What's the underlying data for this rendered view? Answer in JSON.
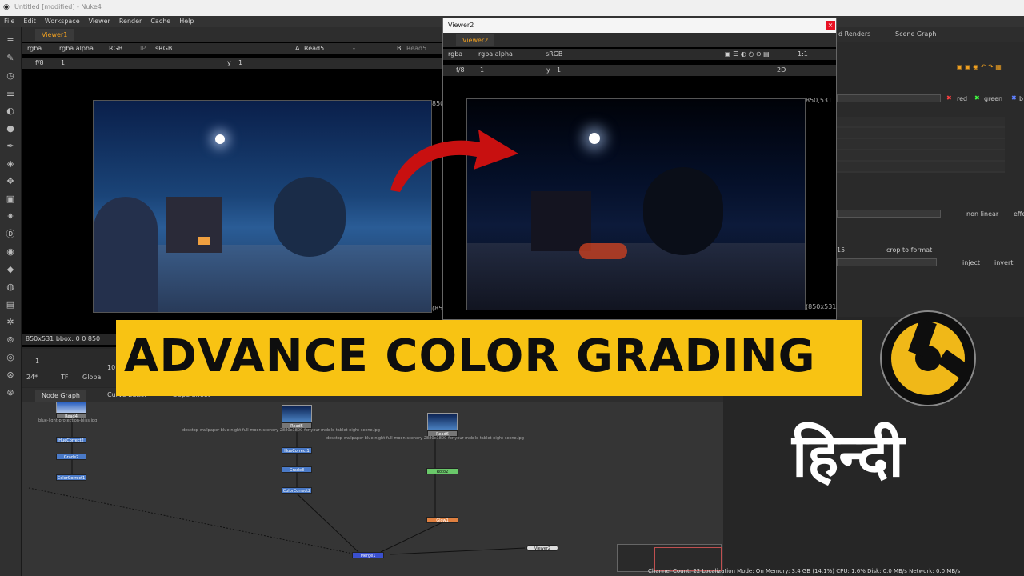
{
  "window": {
    "title": "Untitled [modified] - Nuke4"
  },
  "menu": [
    "File",
    "Edit",
    "Workspace",
    "Viewer",
    "Render",
    "Cache",
    "Help"
  ],
  "viewer1": {
    "tab": "Viewer1",
    "channels": "rgba",
    "alpha": "rgba.alpha",
    "rgb": "RGB",
    "ip": "IP",
    "lut": "sRGB",
    "a_label": "A",
    "a_input": "Read5",
    "dash": "-",
    "b_label": "B",
    "b_input": "Read5",
    "fstop": "f/8",
    "frame": "1",
    "y_label": "y",
    "y_value": "1",
    "format_right": "850",
    "format_bottom": "(85",
    "info": "850x531  bbox: 0 0 850"
  },
  "viewer2": {
    "window_title": "Viewer2",
    "tab": "Viewer2",
    "channels": "rgba",
    "alpha": "rgba.alpha",
    "lut": "sRGB",
    "fstop": "f/8",
    "frame": "1",
    "y_label": "y",
    "y_value": "1",
    "zoom": "1:1",
    "mode": "2D",
    "format_top": "850,531",
    "format_bottom": "(850x531"
  },
  "right_panel": {
    "tabs": [
      "d Renders",
      "Scene Graph"
    ],
    "channel_red": "red",
    "channel_green": "green",
    "channel_b": "b",
    "non_linear": "non linear",
    "effect": "effe",
    "crop_value": "15",
    "crop_to_format": "crop to format",
    "inject": "inject",
    "invert": "invert"
  },
  "timeline": {
    "fps": "24*",
    "tf": "TF",
    "scope": "Global",
    "start": "1",
    "mark": "10"
  },
  "node_graph": {
    "tab": "Node Graph",
    "tab2": "Curve Editor",
    "tab3": "Dope Sheet",
    "nodes": [
      "Read4",
      "HueCorrect2",
      "Grade2",
      "ColorCorrect1",
      "Read5",
      "HueCorrect1",
      "Grade3",
      "ColorCorrect2",
      "Read6",
      "Roto2",
      "Glow1",
      "Merge1",
      "Viewer2"
    ],
    "read4_file": "blue-light-protection-bliss.jpg",
    "read5_file": "desktop-wallpaper-blue-night-full-moon-scenery-2880x1800-for-your-mobile-tablet-night-scene.jpg",
    "read6_file": "desktop-wallpaper-blue-night-full-moon-scenery-2880x1800-for-your-mobile-tablet-night-scene.jpg"
  },
  "banner": {
    "text": "ADVANCE COLOR GRADING",
    "hindi": "हिन्दी"
  },
  "status": "Channel Count: 22  Localization Mode: On  Memory: 3.4 GB (14.1%)  CPU: 1.6%  Disk: 0.0 MB/s  Network: 0.0 MB/s",
  "colors": {
    "accent": "#f0a020",
    "banner": "#f8c313",
    "arrow": "#c81010",
    "logo": "#f0b818"
  },
  "icons": [
    "brush-icon",
    "clock-icon",
    "menu-icon",
    "circle-icon",
    "box-icon",
    "layers-icon",
    "move-icon",
    "cube-icon",
    "particles-icon",
    "eye-icon",
    "tag-icon",
    "gear-icon"
  ]
}
